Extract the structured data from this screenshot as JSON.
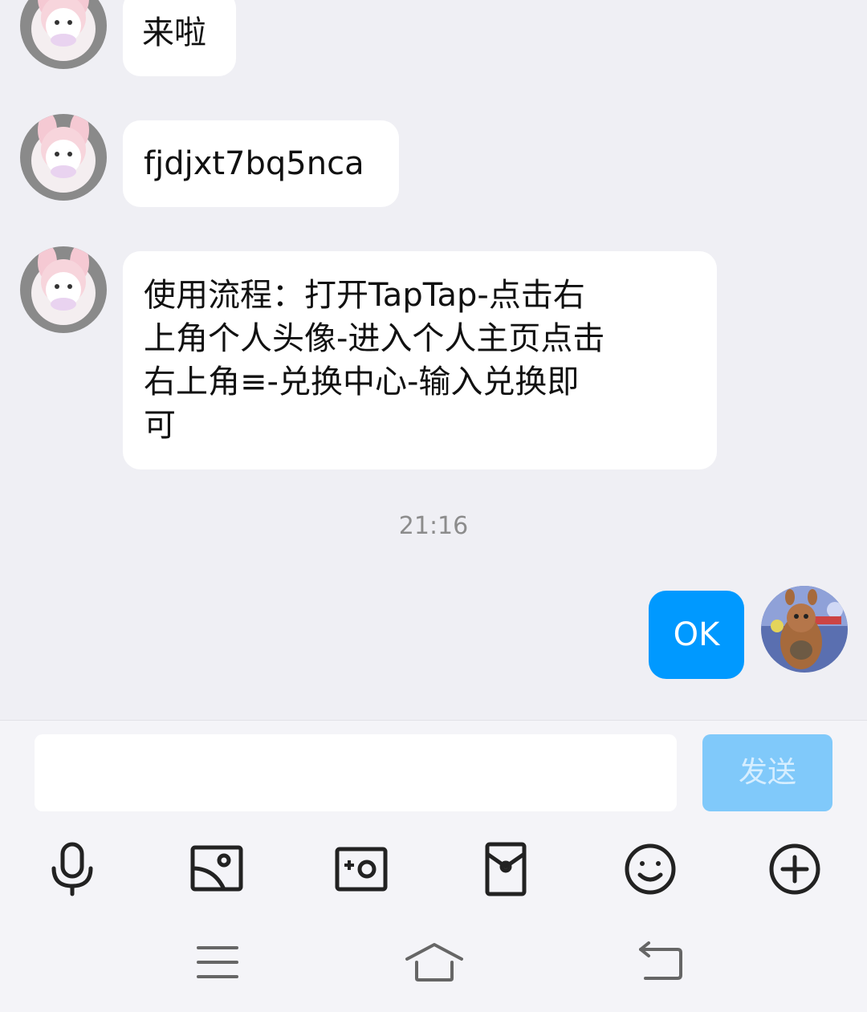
{
  "messages": [
    {
      "sender": "other",
      "text": "来啦"
    },
    {
      "sender": "other",
      "text": "fjdjxt7bq5nca"
    },
    {
      "sender": "other",
      "lines": [
        "使用流程：打开TapTap-点击右",
        "上角个人头像-进入个人主页点击",
        "右上角≡-兑换中心-输入兑换即",
        "可"
      ]
    },
    {
      "sender": "me",
      "text": "OK"
    }
  ],
  "timestamp": "21:16",
  "input": {
    "value": "",
    "placeholder": ""
  },
  "send_label": "发送",
  "toolbar_icons": [
    "microphone-icon",
    "image-icon",
    "camera-icon",
    "red-packet-icon",
    "emoji-icon",
    "plus-icon"
  ],
  "nav_icons": [
    "menu-icon",
    "home-icon",
    "back-icon"
  ],
  "colors": {
    "background": "#efeff4",
    "bubble_other": "#ffffff",
    "bubble_me": "#0099ff",
    "send_disabled": "#80c9fa",
    "timestamp": "#8c8c8c"
  }
}
